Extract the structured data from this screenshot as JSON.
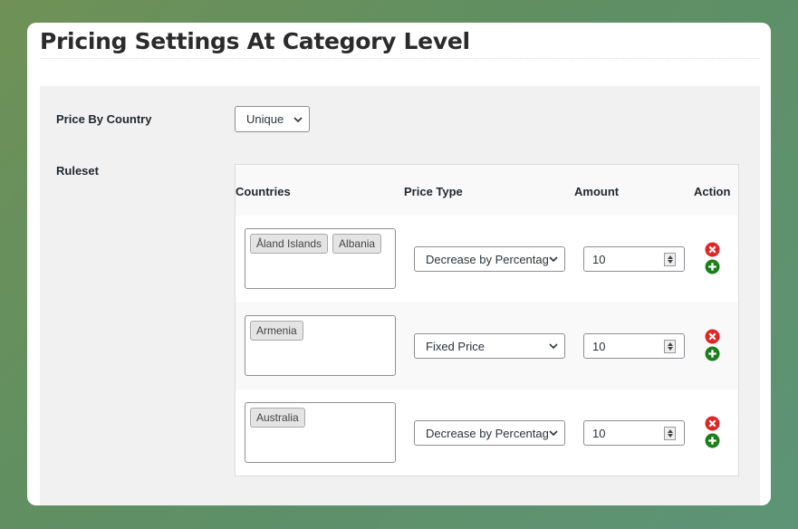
{
  "page": {
    "title": "Pricing Settings At Category Level"
  },
  "price_by_country": {
    "label": "Price By Country",
    "selected": "Unique"
  },
  "ruleset": {
    "label": "Ruleset",
    "columns": [
      "Countries",
      "Price Type",
      "Amount",
      "Action"
    ],
    "rows": [
      {
        "countries": [
          "Åland Islands",
          "Albania"
        ],
        "price_type": "Decrease by Percentage",
        "amount": "10"
      },
      {
        "countries": [
          "Armenia"
        ],
        "price_type": "Fixed Price",
        "amount": "10"
      },
      {
        "countries": [
          "Australia"
        ],
        "price_type": "Decrease by Percentage",
        "amount": "10"
      }
    ]
  },
  "icons": {
    "remove": "remove-circle-icon",
    "add": "add-circle-icon",
    "dropdown": "chevron-down-icon"
  },
  "colors": {
    "remove": "#e02424",
    "add": "#1a7f1a"
  }
}
